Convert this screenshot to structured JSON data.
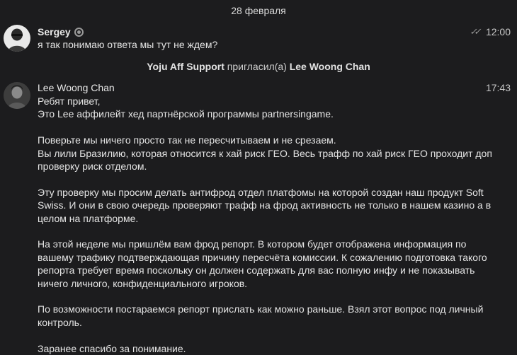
{
  "date_separator": "28 февраля",
  "messages": [
    {
      "sender": "Sergey",
      "time": "12:00",
      "text": "я так понимаю ответа мы тут не ждем?"
    }
  ],
  "service": {
    "actor": "Yoju Aff Support",
    "action": "пригласил(а)",
    "target": "Lee Woong Chan"
  },
  "message2": {
    "sender": "Lee Woong Chan",
    "time": "17:43",
    "paragraphs": [
      "Ребят привет,\nЭто Lee аффилейт хед партнёрской программы partnersingame.",
      "Поверьте мы ничего просто так не пересчитываем и не срезаем.\nВы лили Бразилию, которая относится к хай риск ГЕО. Весь трафф по хай риск ГЕО проходит доп проверку риск отделом.",
      "Эту проверку мы просим делать антифрод отдел платфомы на которой создан наш продукт Soft Swiss. И они в свою очередь проверяют трафф на фрод активность не только в нашем казино  а в целом на платформе.",
      "На этой неделе мы пришлём вам фрод репорт. В котором будет отображена информация по вашему трафику подтверждающая причину пересчёта комиссии. К сожалению подготовка такого репорта требует время поскольку он должен содержать для вас полную инфу и не показывать ничего личного, конфиденциального игроков.",
      "По возможности постараемся репорт прислать как можно раньше. Взял этот вопрос под личный контроль.",
      "Заранее спасибо за понимание."
    ]
  }
}
